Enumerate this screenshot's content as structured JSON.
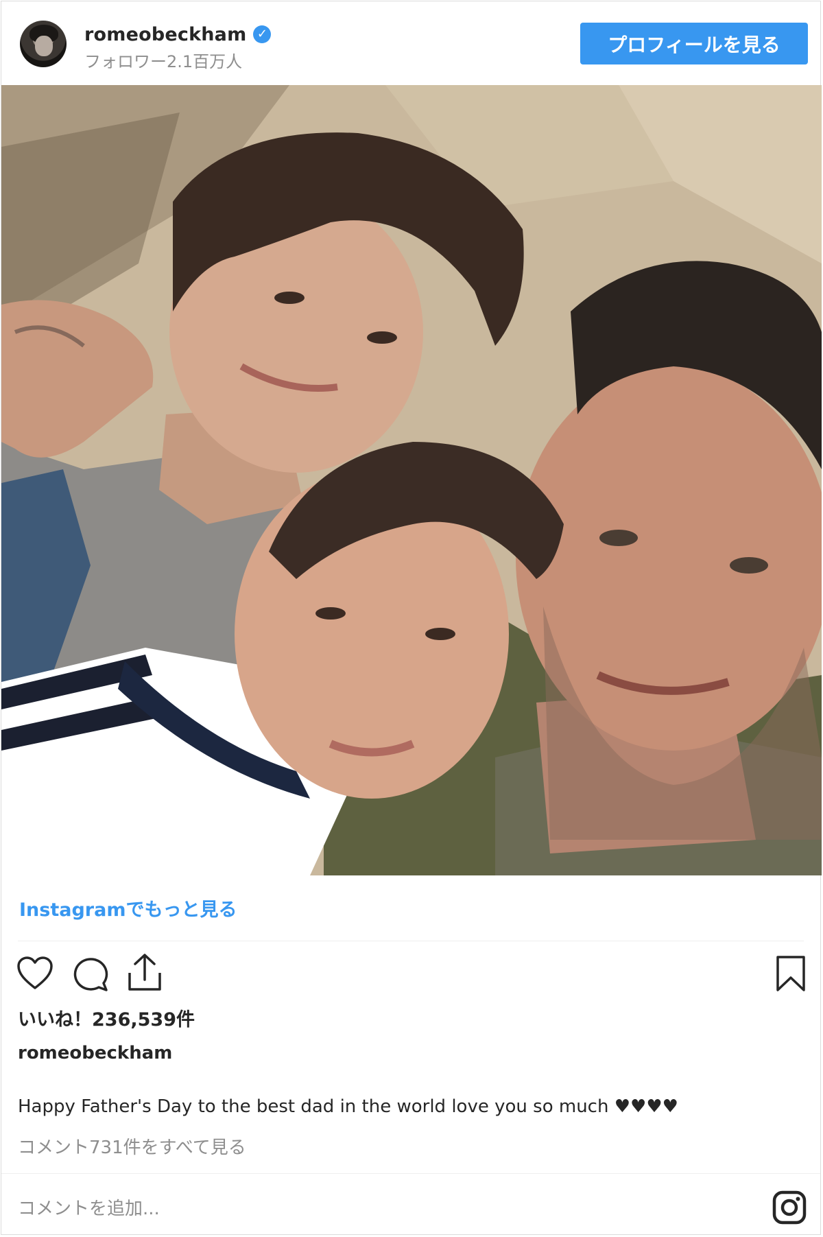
{
  "header": {
    "username": "romeobeckham",
    "verified_glyph": "✓",
    "followers": "フォロワー2.1百万人",
    "profile_button": "プロフィールを見る"
  },
  "photo": {
    "description_icon": "selfie-photo"
  },
  "more_link": "Instagramでもっと見る",
  "actions": {
    "like_icon": "heart-icon",
    "comment_icon": "comment-icon",
    "share_icon": "share-icon",
    "save_icon": "bookmark-icon"
  },
  "likes": "いいね！236,539件",
  "caption": {
    "username": "romeobeckham",
    "text": "Happy Father's Day to the best dad in the world love you so much ♥♥♥♥"
  },
  "view_comments": "コメント731件をすべて見る",
  "add_comment": {
    "placeholder": "コメントを追加..."
  },
  "colors": {
    "accent": "#3897f0",
    "text": "#262626",
    "muted": "#8e8e8e"
  }
}
